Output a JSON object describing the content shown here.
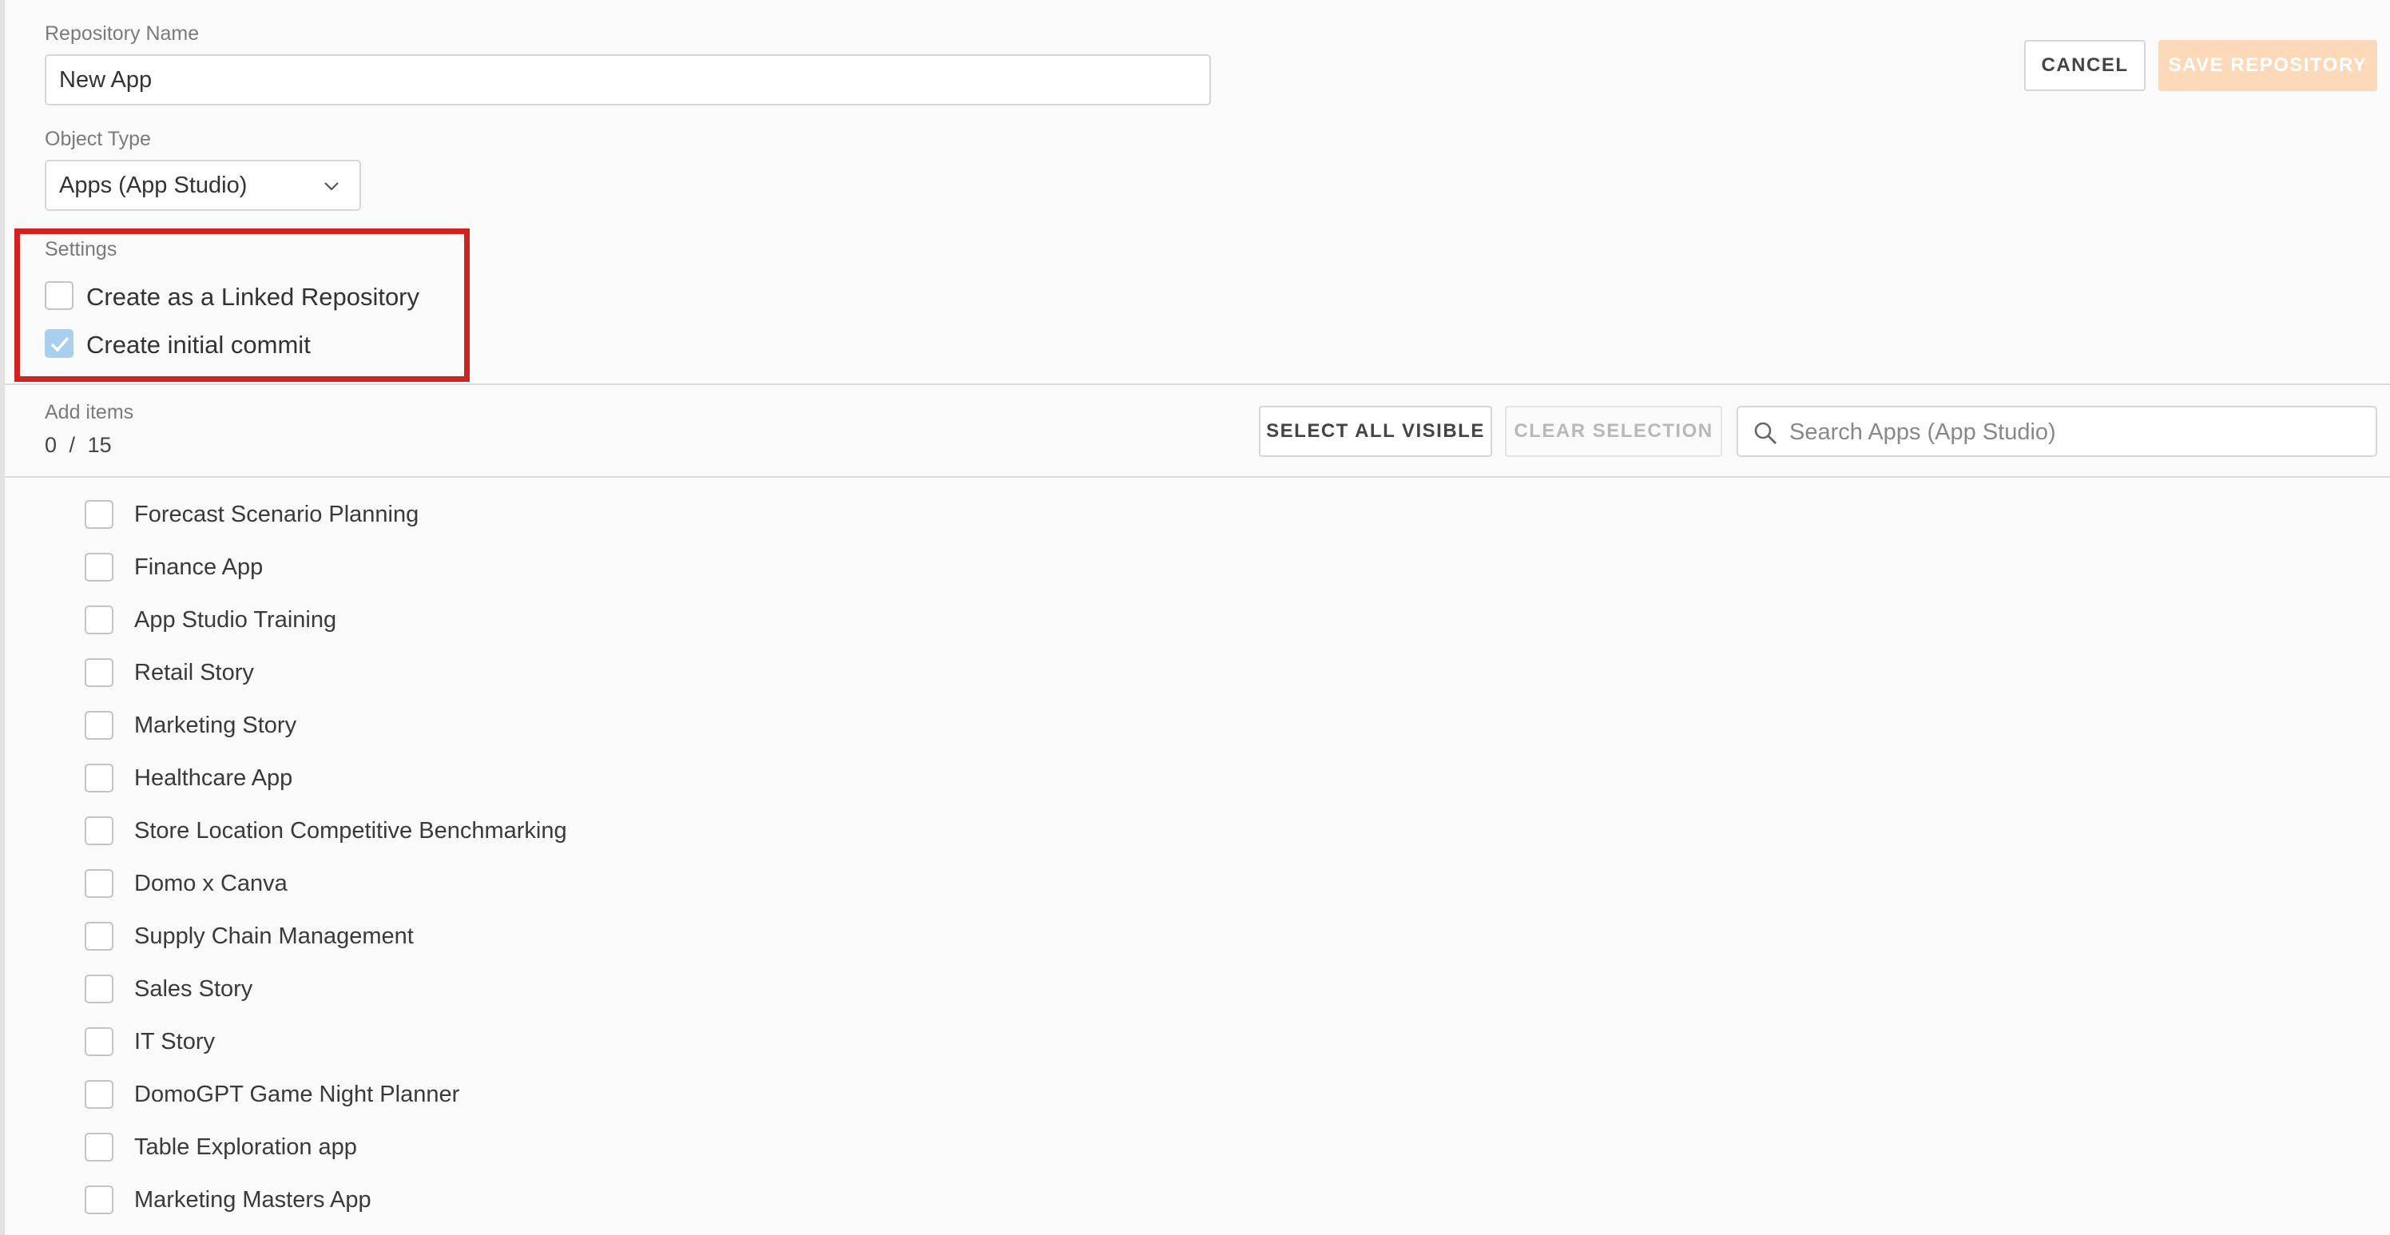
{
  "form": {
    "repo_name_label": "Repository Name",
    "repo_name_value": "New App",
    "object_type_label": "Object Type",
    "object_type_value": "Apps (App Studio)"
  },
  "header": {
    "cancel_label": "CANCEL",
    "save_label": "SAVE REPOSITORY"
  },
  "settings": {
    "title": "Settings",
    "linked_repo_label": "Create as a Linked Repository",
    "linked_repo_checked": false,
    "initial_commit_label": "Create initial commit",
    "initial_commit_checked": true
  },
  "add_items": {
    "title": "Add items",
    "selected_count": "0",
    "separator": "/",
    "total_count": "15",
    "select_all_label": "SELECT ALL VISIBLE",
    "clear_selection_label": "CLEAR SELECTION",
    "search_placeholder": "Search Apps (App Studio)"
  },
  "items": [
    {
      "label": "Forecast Scenario Planning",
      "checked": false
    },
    {
      "label": "Finance App",
      "checked": false
    },
    {
      "label": "App Studio Training",
      "checked": false
    },
    {
      "label": "Retail Story",
      "checked": false
    },
    {
      "label": "Marketing Story",
      "checked": false
    },
    {
      "label": "Healthcare App",
      "checked": false
    },
    {
      "label": "Store Location Competitive Benchmarking",
      "checked": false
    },
    {
      "label": "Domo x Canva",
      "checked": false
    },
    {
      "label": "Supply Chain Management",
      "checked": false
    },
    {
      "label": "Sales Story",
      "checked": false
    },
    {
      "label": "IT Story",
      "checked": false
    },
    {
      "label": "DomoGPT Game Night Planner",
      "checked": false
    },
    {
      "label": "Table Exploration app",
      "checked": false
    },
    {
      "label": "Marketing Masters App",
      "checked": false
    }
  ],
  "colors": {
    "accent_orange_disabled": "#fbd9b9",
    "checkbox_checked": "#a9cfee",
    "highlight_red": "#d0221f"
  }
}
